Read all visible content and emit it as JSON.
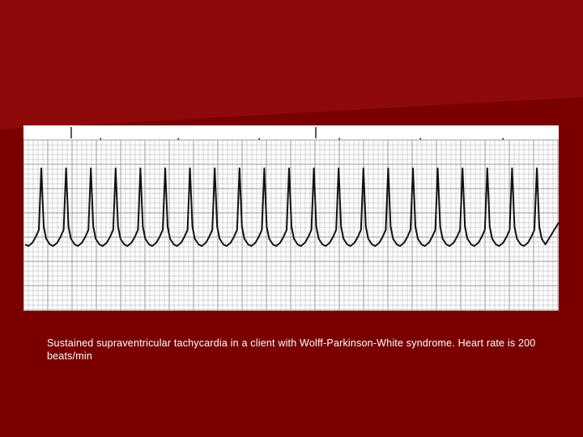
{
  "slide": {
    "background_color": "#7a0000",
    "highlight_color": "#8e0a0a",
    "caption": "Sustained supraventricular tachycardia in a client with Wolff-Parkinson-White syndrome. Heart rate is 200 beats/min"
  },
  "ecg_strip": {
    "paper_color": "#ffffff",
    "grid_color": "#9a9a9a",
    "trace_color": "#111111",
    "heart_rate_bpm": 200
  }
}
